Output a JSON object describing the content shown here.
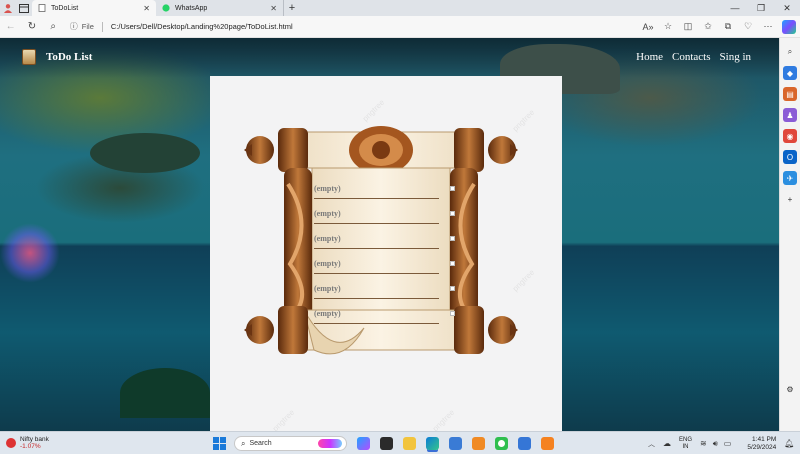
{
  "browser": {
    "tabs": [
      {
        "title": "ToDoList",
        "active": true
      },
      {
        "title": "WhatsApp",
        "active": false
      }
    ],
    "address": {
      "prefix": "File",
      "url": "C:/Users/Dell/Desktop/Landing%20page/ToDoList.html"
    }
  },
  "site": {
    "brand": "ToDo List",
    "nav": [
      "Home",
      "Contacts",
      "Sing in"
    ]
  },
  "todo": {
    "items": [
      "(empty)",
      "(empty)",
      "(empty)",
      "(empty)",
      "(empty)",
      "(empty)"
    ]
  },
  "watermark": "pngtree",
  "taskbar": {
    "stock": {
      "name": "Nifty bank",
      "change": "-1.07%"
    },
    "search_label": "Search",
    "lang": {
      "line1": "ENG",
      "line2": "IN"
    },
    "clock": {
      "time": "1:41 PM",
      "date": "5/29/2024"
    }
  },
  "colors": {
    "accent": "#1b7ad9",
    "page_card": "#f3f3f4",
    "scroll_wood": "#8a4a1c",
    "stock_down": "#c62828"
  }
}
